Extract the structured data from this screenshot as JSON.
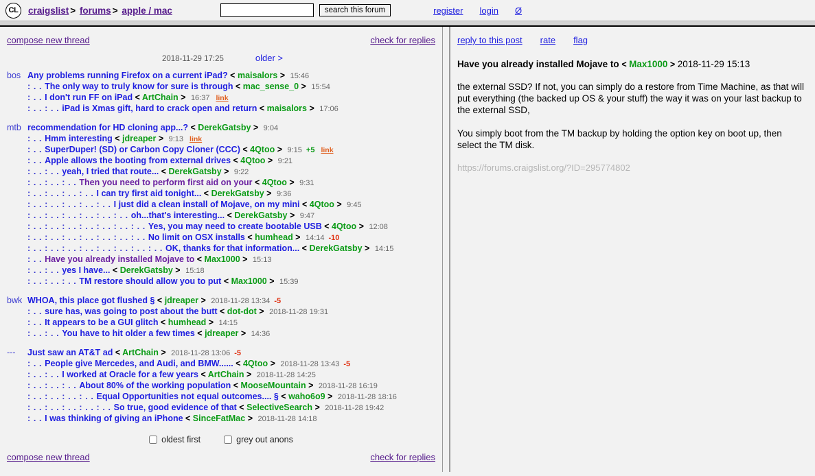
{
  "header": {
    "logo": "CL",
    "breadcrumbs": [
      {
        "label": "craigslist",
        "sep": ">"
      },
      {
        "label": "forums",
        "sep": ">"
      },
      {
        "label": "apple / mac",
        "sep": ""
      }
    ],
    "search": {
      "value": "",
      "placeholder": "",
      "button": "search this forum"
    },
    "account_links": [
      {
        "label": "register"
      },
      {
        "label": "login"
      },
      {
        "label": "Ø"
      }
    ]
  },
  "left": {
    "compose_label": "compose new thread",
    "check_replies_label": "check for replies",
    "pager": {
      "timestamp": "2018-11-29 17:25",
      "older_label": "older >"
    },
    "checkboxes": [
      {
        "label": "oldest first",
        "checked": false
      },
      {
        "label": "grey out anons",
        "checked": false
      }
    ],
    "groups": [
      {
        "prefix": "bos",
        "rows": [
          {
            "indent": "",
            "title": "Any problems running Firefox on a current iPad?",
            "read": false,
            "author": "maisalors",
            "stamp": "15:46",
            "score": "",
            "link": false
          },
          {
            "indent": ": . .",
            "title": "The only way to truly know for sure is through",
            "read": false,
            "author": "mac_sense_0",
            "stamp": "15:54",
            "score": "",
            "link": false
          },
          {
            "indent": ": . .",
            "title": "I don't run FF on iPad",
            "read": false,
            "author": "ArtChain",
            "stamp": "16:37",
            "score": "",
            "link": true
          },
          {
            "indent": ": . . : . .",
            "title": "iPad is Xmas gift, hard to crack open and return",
            "read": false,
            "author": "maisalors",
            "stamp": "17:06",
            "score": "",
            "link": false
          }
        ]
      },
      {
        "prefix": "mtb",
        "rows": [
          {
            "indent": "",
            "title": "recommendation for HD cloning app...?",
            "read": false,
            "author": "DerekGatsby",
            "stamp": "9:04",
            "score": "",
            "link": false
          },
          {
            "indent": ": . .",
            "title": "Hmm interesting",
            "read": false,
            "author": "jdreaper",
            "stamp": "9:13",
            "score": "",
            "link": true
          },
          {
            "indent": ": . .",
            "title": "SuperDuper! (SD) or Carbon Copy Cloner (CCC)",
            "read": false,
            "author": "4Qtoo",
            "stamp": "9:15",
            "score": "+5",
            "link": true
          },
          {
            "indent": ": . .",
            "title": "Apple allows the booting from external drives",
            "read": false,
            "author": "4Qtoo",
            "stamp": "9:21",
            "score": "",
            "link": false
          },
          {
            "indent": ": . . : . .",
            "title": "yeah, I tried that route...",
            "read": false,
            "author": "DerekGatsby",
            "stamp": "9:22",
            "score": "",
            "link": false
          },
          {
            "indent": ": . . : . . : . .",
            "title": "Then you need to perform first aid on your",
            "read": true,
            "author": "4Qtoo",
            "stamp": "9:31",
            "score": "",
            "link": false
          },
          {
            "indent": ": . . : . . : . . : . .",
            "title": "I can try first aid tonight...",
            "read": false,
            "author": "DerekGatsby",
            "stamp": "9:36",
            "score": "",
            "link": false
          },
          {
            "indent": ": . . : . . : . . : . . : . .",
            "title": "I just did a clean install of Mojave, on my mini",
            "read": false,
            "author": "4Qtoo",
            "stamp": "9:45",
            "score": "",
            "link": false
          },
          {
            "indent": ": . . : . . : . . : . . : . . : . .",
            "title": "oh...that's interesting...",
            "read": false,
            "author": "DerekGatsby",
            "stamp": "9:47",
            "score": "",
            "link": false
          },
          {
            "indent": ": . . : . . : . . : . . : . . : . . : . .",
            "title": "Yes, you may need to create bootable USB",
            "read": false,
            "author": "4Qtoo",
            "stamp": "12:08",
            "score": "",
            "link": false
          },
          {
            "indent": ": . . : . . : . . : . . : . . : . . : . .",
            "title": "No limit on OSX installs",
            "read": false,
            "author": "humhead",
            "stamp": "14:14",
            "score": "-10",
            "link": false
          },
          {
            "indent": ": . . : . . : . . : . . : . . : . . : . . : . .",
            "title": "OK, thanks for that information...",
            "read": false,
            "author": "DerekGatsby",
            "stamp": "14:15",
            "score": "",
            "link": false
          },
          {
            "indent": ": . .",
            "title": "Have you already installed Mojave to",
            "read": true,
            "author": "Max1000",
            "stamp": "15:13",
            "score": "",
            "link": false
          },
          {
            "indent": ": . . : . .",
            "title": "yes I have...",
            "read": false,
            "author": "DerekGatsby",
            "stamp": "15:18",
            "score": "",
            "link": false
          },
          {
            "indent": ": . . : . . : . .",
            "title": "TM restore should allow you to put",
            "read": false,
            "author": "Max1000",
            "stamp": "15:39",
            "score": "",
            "link": false
          }
        ]
      },
      {
        "prefix": "bwk",
        "rows": [
          {
            "indent": "",
            "title": "WHOA, this place got flushed §",
            "read": false,
            "author": "jdreaper",
            "stamp": "2018-11-28 13:34",
            "score": "-5",
            "link": false
          },
          {
            "indent": ": . .",
            "title": "sure has, was going to post about the butt",
            "read": false,
            "author": "dot-dot",
            "stamp": "2018-11-28 19:31",
            "score": "",
            "link": false
          },
          {
            "indent": ": . .",
            "title": "It appears to be a GUI glitch",
            "read": false,
            "author": "humhead",
            "stamp": "14:15",
            "score": "",
            "link": false
          },
          {
            "indent": ": . . : . .",
            "title": "You have to hit older a few times",
            "read": false,
            "author": "jdreaper",
            "stamp": "14:36",
            "score": "",
            "link": false
          }
        ]
      },
      {
        "prefix": "---",
        "rows": [
          {
            "indent": "",
            "title": "Just saw an AT&T ad",
            "read": false,
            "author": "ArtChain",
            "stamp": "2018-11-28 13:06",
            "score": "-5",
            "link": false
          },
          {
            "indent": ": . .",
            "title": "People give Mercedes, and Audi, and BMW......",
            "read": false,
            "author": "4Qtoo",
            "stamp": "2018-11-28 13:43",
            "score": "-5",
            "link": false
          },
          {
            "indent": ": . . : . .",
            "title": "I worked at Oracle for a few years",
            "read": false,
            "author": "ArtChain",
            "stamp": "2018-11-28 14:25",
            "score": "",
            "link": false
          },
          {
            "indent": ": . . : . . : . .",
            "title": "About 80% of the working population",
            "read": false,
            "author": "MooseMountain",
            "stamp": "2018-11-28 16:19",
            "score": "",
            "link": false
          },
          {
            "indent": ": . . : . . : . . : . .",
            "title": "Equal Opportunities not equal outcomes.... §",
            "read": false,
            "author": "waho6o9",
            "stamp": "2018-11-28 18:16",
            "score": "",
            "link": false
          },
          {
            "indent": ": . . : . . : . . : . . : . .",
            "title": "So true, good evidence of that",
            "read": false,
            "author": "SelectiveSearch",
            "stamp": "2018-11-28 19:42",
            "score": "",
            "link": false
          },
          {
            "indent": ": . .",
            "title": "I was thinking of giving an iPhone",
            "read": false,
            "author": "SinceFatMac",
            "stamp": "2018-11-28 14:18",
            "score": "",
            "link": false
          }
        ]
      }
    ]
  },
  "right": {
    "actions": [
      {
        "label": "reply to this post"
      },
      {
        "label": "rate"
      },
      {
        "label": "flag"
      }
    ],
    "post": {
      "title": "Have you already installed Mojave to",
      "author": "Max1000",
      "timestamp": "2018-11-29 15:13",
      "paragraphs": [
        "the external SSD? If not, you can simply do a restore from Time Machine, as that will put everything (the backed up OS & your stuff) the way it was on your last backup to the external SSD,",
        "You simply boot from the TM backup by holding the option key on boot up, then select the TM disk."
      ],
      "url": "https://forums.craigslist.org/?ID=295774802"
    }
  },
  "colors": {
    "link_blue": "#2020e0",
    "link_visited": "#551a8b",
    "author_green": "#0b9b16",
    "score_pos": "#0b9b16",
    "score_neg": "#e03010",
    "tag_orange": "#e06020"
  }
}
